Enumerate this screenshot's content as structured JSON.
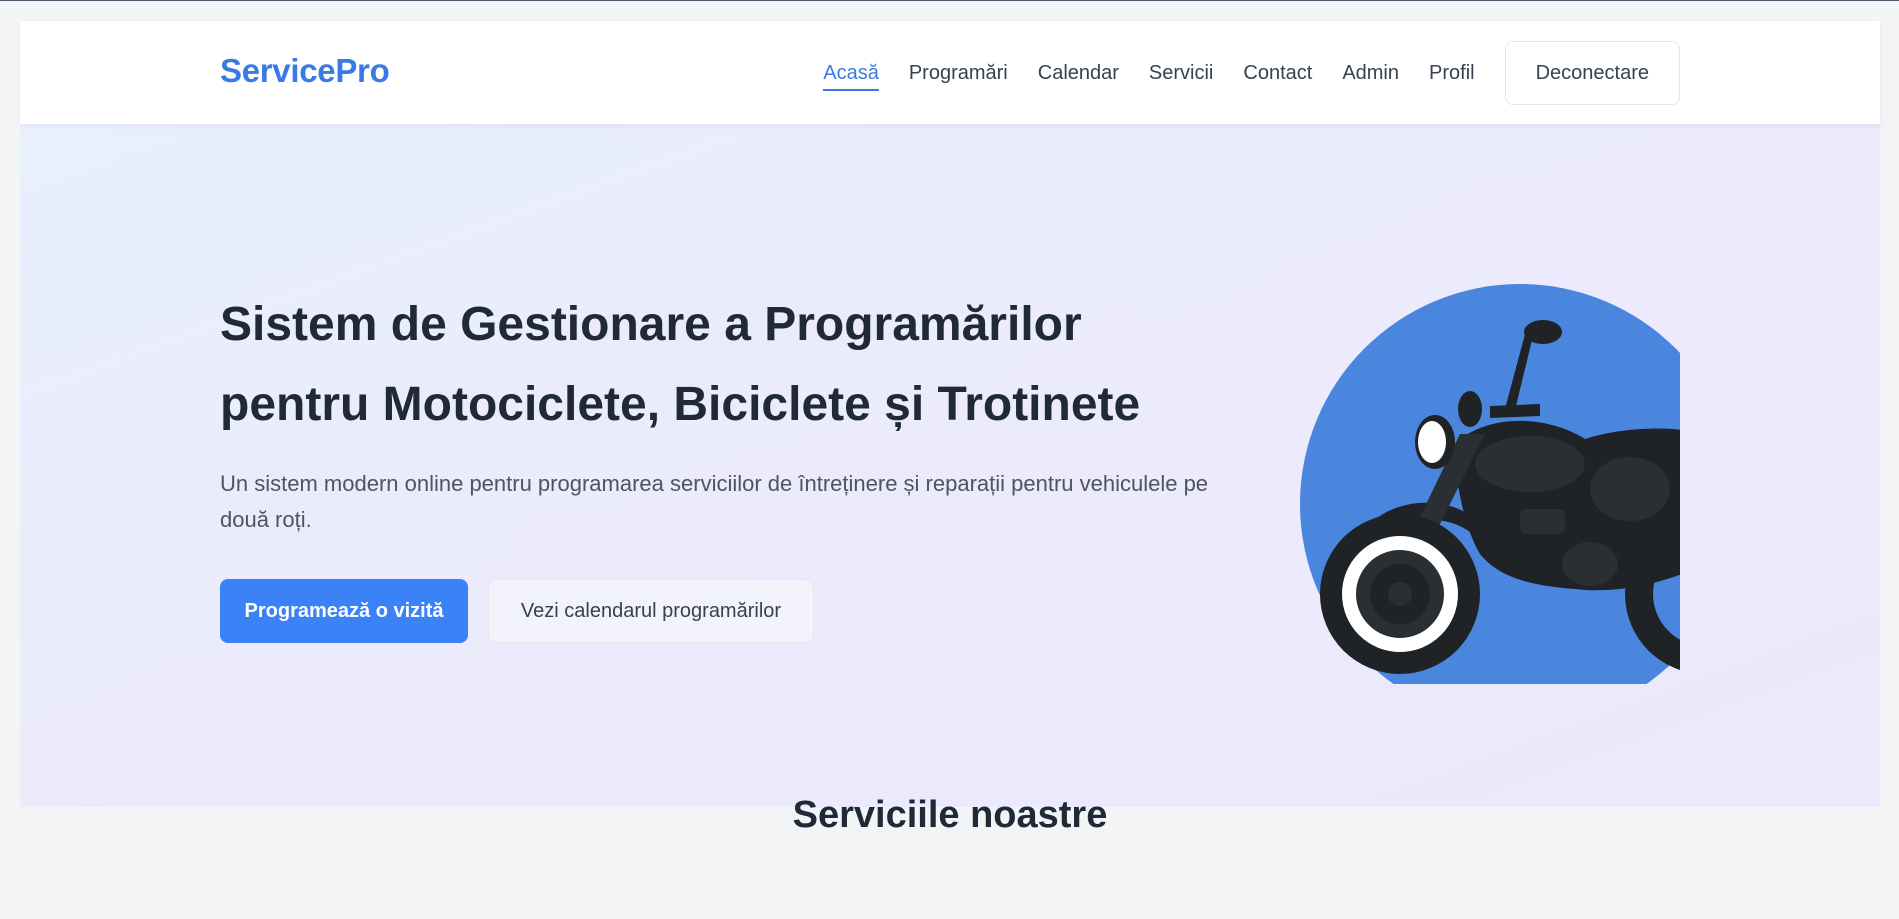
{
  "header": {
    "logo": "ServicePro",
    "nav": [
      {
        "label": "Acasă",
        "active": true
      },
      {
        "label": "Programări"
      },
      {
        "label": "Calendar"
      },
      {
        "label": "Servicii"
      },
      {
        "label": "Contact"
      },
      {
        "label": "Admin"
      },
      {
        "label": "Profil"
      }
    ],
    "logout_label": "Deconectare"
  },
  "hero": {
    "title_line1": "Sistem de Gestionare a Programărilor",
    "title_line2": "pentru Motociclete, Biciclete și Trotinete",
    "subtitle": "Un sistem modern online pentru programarea serviciilor de întreținere și reparații pentru vehiculele pe două roți.",
    "primary_button": "Programează o vizită",
    "secondary_button": "Vezi calendarul programărilor",
    "illustration": "motorcycle-illustration"
  },
  "services": {
    "section_title": "Serviciile noastre"
  },
  "colors": {
    "accent": "#3b7ae6",
    "primary_button": "#3b82f6",
    "illustration_circle": "#4a86de",
    "illustration_body": "#1f2326"
  }
}
